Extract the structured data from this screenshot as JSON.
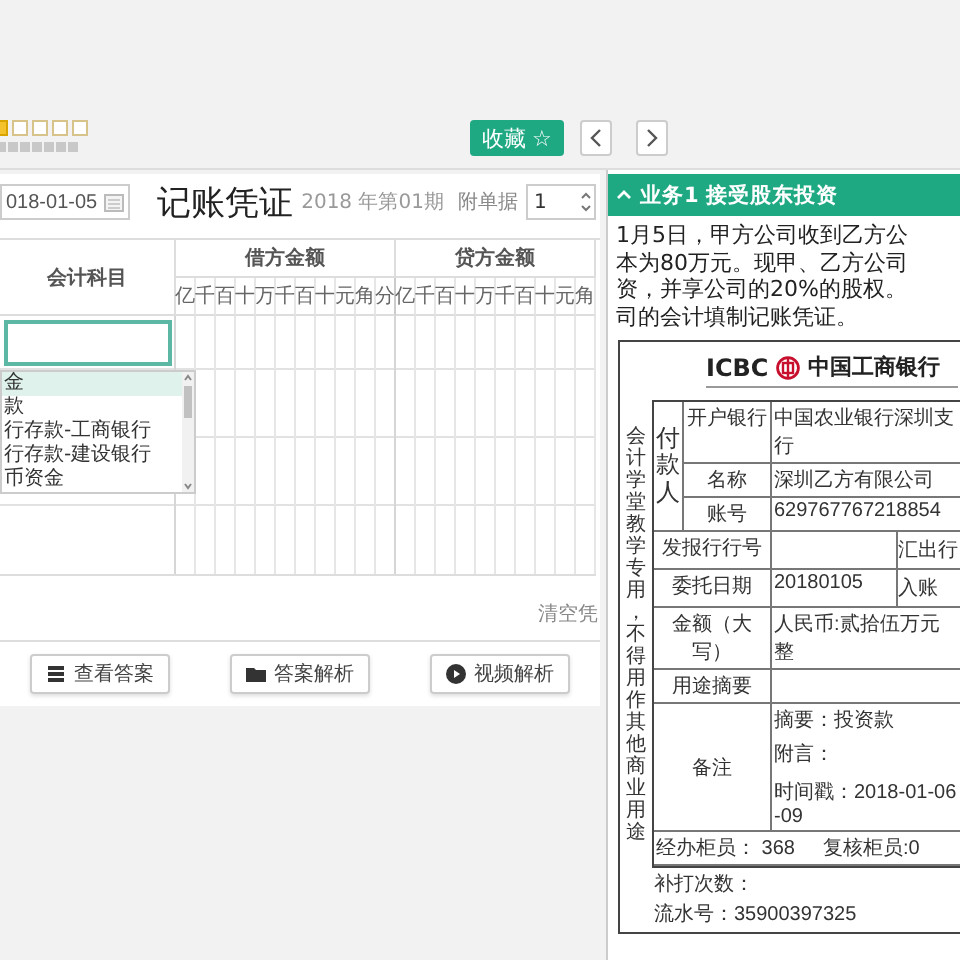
{
  "rating": {
    "stars": 1
  },
  "favorite_button": {
    "label": "收藏",
    "icon": "☆"
  },
  "voucher": {
    "date": "018-01-05",
    "title": "记账凭证",
    "period": "2018 年第01期",
    "attachment_label": "附单据",
    "attachment_count": "1"
  },
  "table": {
    "subject_header": "会计科目",
    "debit_header": "借方金额",
    "credit_header": "贷方金额",
    "debit_units": [
      "亿",
      "千",
      "百",
      "十",
      "万",
      "千",
      "百",
      "十",
      "元",
      "角",
      "分"
    ],
    "credit_units": [
      "亿",
      "千",
      "百",
      "十",
      "万",
      "千",
      "百",
      "十",
      "元",
      "角"
    ]
  },
  "subject_options": [
    {
      "label": "金",
      "selected": true
    },
    {
      "label": "款",
      "selected": false
    },
    {
      "label": "行存款-工商银行",
      "selected": false
    },
    {
      "label": "行存款-建设银行",
      "selected": false
    },
    {
      "label": "币资金",
      "selected": false
    }
  ],
  "clear_link": "清空凭",
  "actions": [
    {
      "kind": "answer",
      "label": "查看答案"
    },
    {
      "kind": "analysis",
      "label": "答案解析"
    },
    {
      "kind": "video",
      "label": "视频解析"
    }
  ],
  "task": {
    "title": "业务1 接受股东投资",
    "expanded": true,
    "lines": [
      "1月5日，甲方公司收到乙方公",
      "本为80万元。现甲、乙方公司",
      "资，并享公司的20%的股权。",
      "司的会计填制记账凭证。"
    ]
  },
  "bank_slip": {
    "bank_latin": "ICBC",
    "bank_name": "中国工商银行",
    "side_note": "会计学堂教学专用，不得用作其他商业用途",
    "payer_label": "付款人",
    "payer_rows": [
      {
        "label": "开户银行",
        "value": "中国农业银行深圳支行"
      },
      {
        "label": "名称",
        "value": "深圳乙方有限公司"
      },
      {
        "label": "账号",
        "value": "629767767218854"
      }
    ],
    "rows": [
      {
        "kind": "split",
        "label": "发报行行号",
        "extra": "汇出行"
      },
      {
        "kind": "split",
        "label": "委托日期",
        "value": "20180105",
        "extra": "入账"
      },
      {
        "kind": "full",
        "label": "金额（大写）",
        "value": "人民币:贰拾伍万元整"
      },
      {
        "kind": "full",
        "label": "用途摘要"
      },
      {
        "kind": "notes",
        "label": "备注",
        "lines": [
          "摘要：投资款",
          "附言：",
          "时间戳：2018-01-06-09"
        ]
      }
    ],
    "clerks": [
      "经办柜员： 368",
      "复核柜员:0"
    ],
    "footer_lines": [
      "补打次数：",
      "流水号：35900397325"
    ]
  }
}
